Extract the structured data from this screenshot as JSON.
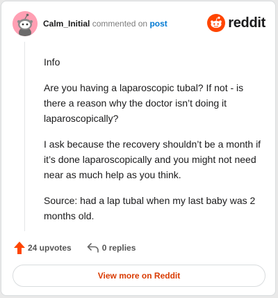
{
  "header": {
    "username": "Calm_Initial",
    "action_text": "commented on",
    "post_link": "post",
    "brand": "reddit"
  },
  "comment": {
    "paragraphs": [
      "Info",
      "Are you having a laparoscopic tubal? If not - is there a reason why the doctor isn’t doing it laparoscopically?",
      "I ask because the recovery shouldn’t be a month if it’s done laparoscopically and you might not need near as much help as you think.",
      "Source: had a lap tubal when my last baby was 2 months old."
    ]
  },
  "actions": {
    "upvotes": "24 upvotes",
    "replies": "0 replies"
  },
  "footer": {
    "view_label": "View more on Reddit"
  },
  "colors": {
    "accent": "#ff4500",
    "link": "#0079d3",
    "button_text": "#d93a00",
    "avatar_bg": "#ff9fb3"
  },
  "icons": {
    "avatar": "snoo-avatar-icon",
    "brand": "reddit-logo-icon",
    "upvote": "upvote-arrow-icon",
    "reply": "reply-arrow-icon"
  }
}
